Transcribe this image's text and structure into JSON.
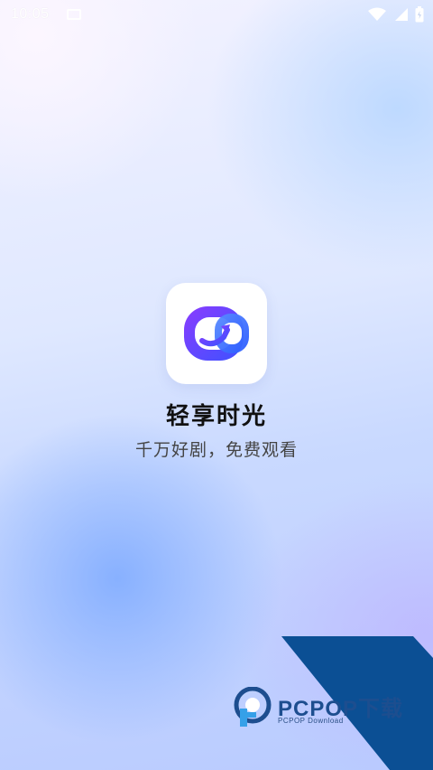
{
  "status_bar": {
    "time": "10:05"
  },
  "app": {
    "name": "轻享时光",
    "slogan": "千万好剧，免费观看"
  },
  "watermark": {
    "title": "PCPOP下载",
    "subtitle": "PCPOP Download"
  },
  "colors": {
    "icon_gradient_start": "#7a3cff",
    "icon_gradient_end": "#3f4cff",
    "watermark_band": "#0b4f94"
  }
}
